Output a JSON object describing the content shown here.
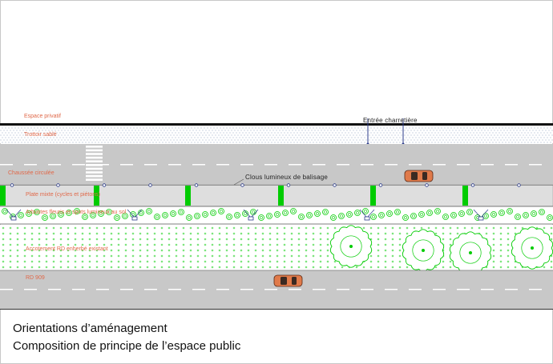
{
  "labels": {
    "espace_prive": "Espace privatif",
    "trottoir": "Trottoir sablé",
    "chaussee": "Chaussée circulée",
    "plate_mixte": "Plate mixte  (cycles et piétons)",
    "arbustes": "Arbustes fleuris et spots lumineux au sol",
    "accotement": "Accotement RD enherbé existant",
    "rd": "RD 909"
  },
  "annotations": {
    "entree": "Entrée charretière",
    "clous": "Clous lumineux de balisage"
  },
  "caption": {
    "line1": "Orientations d’aménagement",
    "line2": "Composition de principe de l’espace public"
  },
  "colors": {
    "road": "#c8c8c8",
    "verge": "#ffffff",
    "vegetation": "#00cc00",
    "label_text": "#e0694a",
    "car": "#e07a4a"
  }
}
